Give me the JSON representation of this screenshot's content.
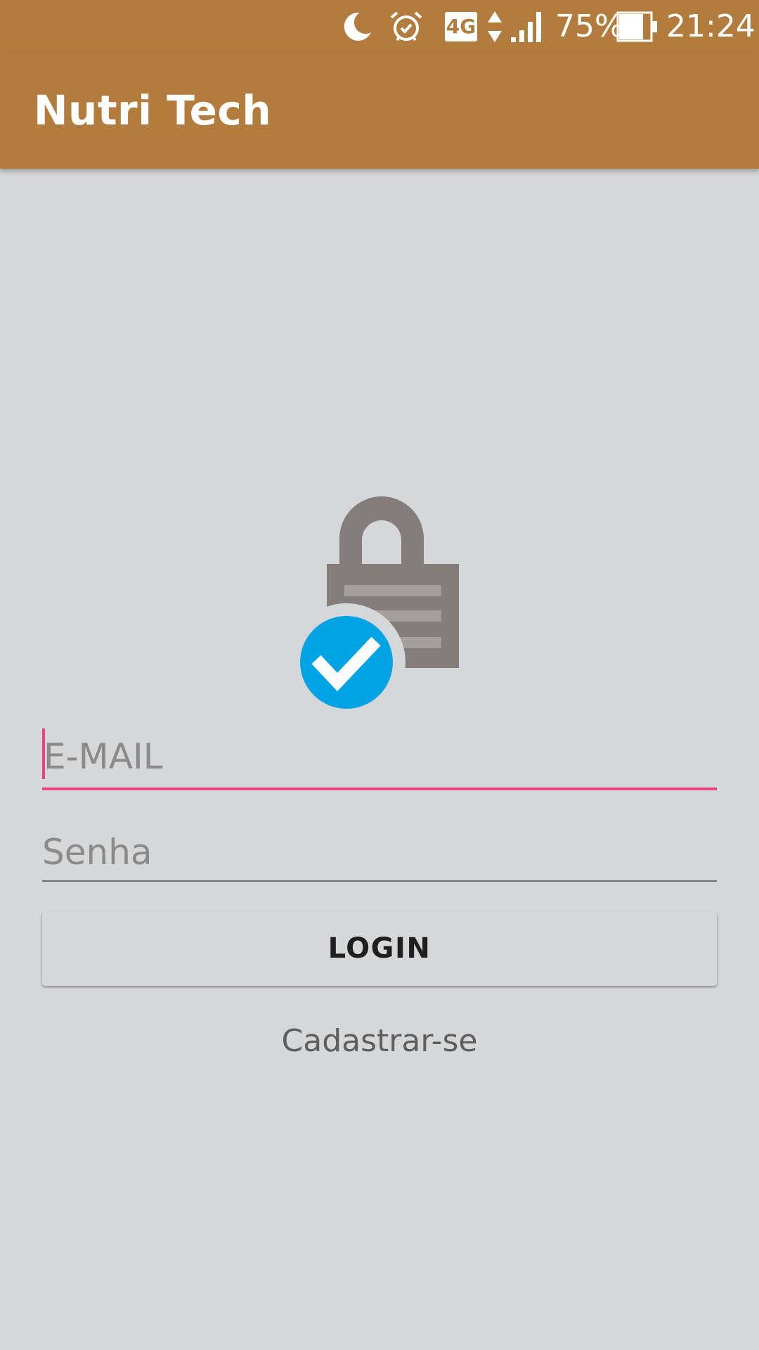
{
  "status_bar": {
    "icons": [
      "moon-icon",
      "alarm-icon",
      "network-4g-icon",
      "data-arrows-icon",
      "signal-icon",
      "battery-icon"
    ],
    "battery_percent": "75%",
    "time": "21:24",
    "network_label": "4G"
  },
  "app_bar": {
    "title": "Nutri Tech"
  },
  "login_form": {
    "email": {
      "placeholder": "E-MAIL",
      "value": ""
    },
    "password": {
      "placeholder": "Senha",
      "value": ""
    },
    "login_label": "LOGIN",
    "signup_label": "Cadastrar-se"
  },
  "colors": {
    "primary": "#b27c3f",
    "accent": "#e8457d",
    "background": "#d6d7d8",
    "check_badge": "#00a4e4",
    "lock": "#857c7c"
  }
}
